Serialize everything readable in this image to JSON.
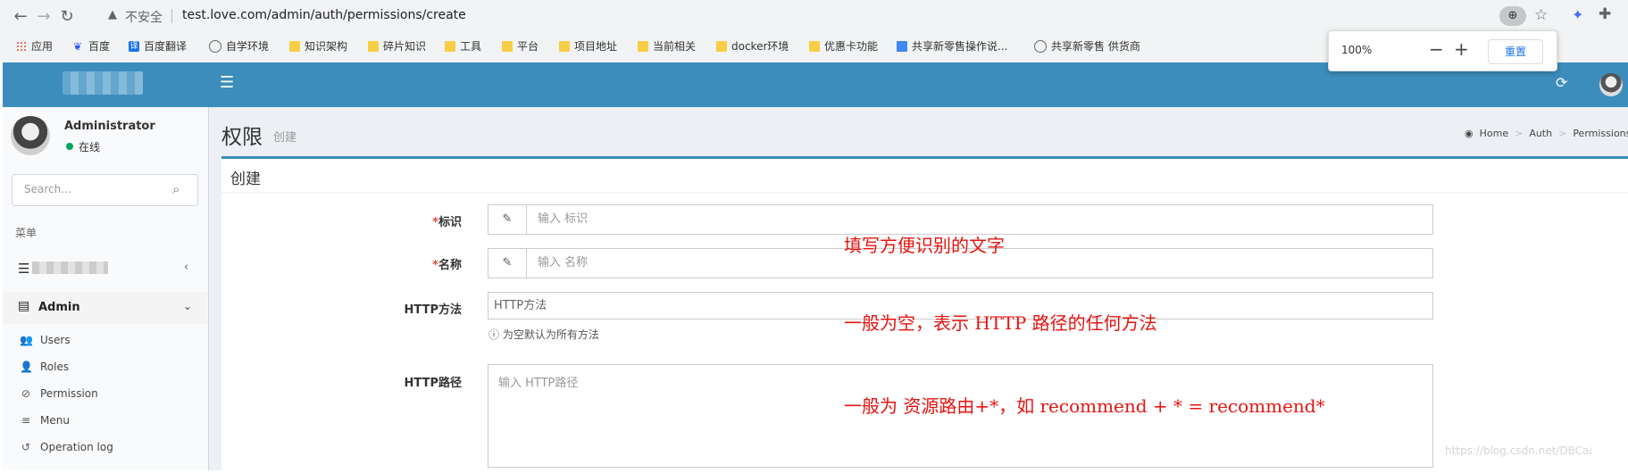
{
  "browser": {
    "insecure_label": "不安全",
    "url": "test.love.com/admin/auth/permissions/create",
    "bookmarks": [
      "应用",
      "百度",
      "百度翻译",
      "自学环境",
      "知识架构",
      "碎片知识",
      "工具",
      "平台",
      "项目地址",
      "当前相关",
      "docker环境",
      "优惠卡功能",
      "共享新零售操作说...",
      "共享新零售 供货商"
    ],
    "zoom_popup": {
      "value": "100%",
      "minus": "−",
      "plus": "+",
      "reset": "重置"
    }
  },
  "sidebar": {
    "user_name": "Administrator",
    "status": "在线",
    "search_placeholder": "Search...",
    "menu_header": "菜单",
    "admin_label": "Admin",
    "sub_items": [
      "Users",
      "Roles",
      "Permission",
      "Menu",
      "Operation log"
    ]
  },
  "content": {
    "title": "权限",
    "subtitle": "创建",
    "breadcrumb": [
      "Home",
      "Auth",
      "Permissions"
    ],
    "box_title": "创建",
    "form": {
      "slug_label": "标识",
      "slug_placeholder": "输入 标识",
      "name_label": "名称",
      "name_placeholder": "输入 名称",
      "method_label": "HTTP方法",
      "method_value": "HTTP方法",
      "method_help": "为空默认为所有方法",
      "path_label": "HTTP路径",
      "path_placeholder": "输入 HTTP路径"
    }
  },
  "annotations": [
    "填写方便识别的文字",
    "一般为空，表示 HTTP 路径的任何方法",
    "一般为 资源路由+*，如 recommend + * = recommend*"
  ],
  "watermark": "https://blog.csdn.net/DBCai",
  "colors": {
    "header": "#3c8dbc",
    "annotation": "#e6130f",
    "required": "#dd4b39",
    "online": "#00a65a"
  }
}
